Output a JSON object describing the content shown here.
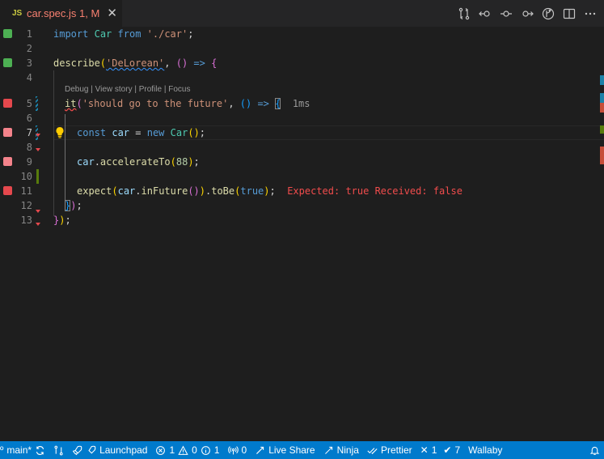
{
  "tab": {
    "icon": "JS",
    "label": "car.spec.js 1, M",
    "close": "✕"
  },
  "toolbar_icons": [
    "compare-changes-icon",
    "go-back-icon",
    "git-commit-icon",
    "go-forward-icon",
    "git-graph-icon",
    "split-editor-icon",
    "more-actions-icon"
  ],
  "editor": {
    "codelens": "Debug | View story | Profile | Focus",
    "timing": "1ms",
    "error_message": "Expected: true Received: false",
    "lines": [
      {
        "n": "1",
        "marker": "green"
      },
      {
        "n": "2",
        "marker": ""
      },
      {
        "n": "3",
        "marker": "green"
      },
      {
        "n": "4",
        "marker": ""
      },
      {
        "n": "5",
        "marker": "red"
      },
      {
        "n": "6",
        "marker": ""
      },
      {
        "n": "7",
        "marker": "pink"
      },
      {
        "n": "8",
        "marker": ""
      },
      {
        "n": "9",
        "marker": "pink"
      },
      {
        "n": "10",
        "marker": ""
      },
      {
        "n": "11",
        "marker": "red"
      },
      {
        "n": "12",
        "marker": ""
      },
      {
        "n": "13",
        "marker": ""
      }
    ],
    "code": {
      "l1": [
        "import",
        "Car",
        "from",
        "'./car'",
        ";"
      ],
      "l3": [
        "describe",
        "(",
        "'DeLorean'",
        ", ",
        "()",
        " => ",
        "{"
      ],
      "l5": [
        "it",
        "(",
        "'should go to the future'",
        ", ",
        "()",
        " => ",
        "{"
      ],
      "l7": [
        "const",
        "car",
        " = ",
        "new",
        "Car",
        "()",
        ";"
      ],
      "l9": [
        "car",
        ".",
        "accelerateTo",
        "(",
        "88",
        ")",
        ";"
      ],
      "l11": [
        "expect",
        "(",
        "car",
        ".",
        "inFuture",
        "()",
        ")",
        ".",
        "toBe",
        "(",
        "true",
        ")",
        ";"
      ],
      "l12": [
        "}",
        ")",
        ";"
      ],
      "l13": [
        "}",
        ")",
        ";"
      ]
    }
  },
  "status": {
    "branch": "main*",
    "launchpad": "Launchpad",
    "errors": "1",
    "warnings": "0",
    "infos": "1",
    "ports": "0",
    "live_share": "Live Share",
    "ninja": "Ninja",
    "prettier": "Prettier",
    "wallaby_failed": "1",
    "wallaby_passed": "7",
    "wallaby": "Wallaby"
  }
}
